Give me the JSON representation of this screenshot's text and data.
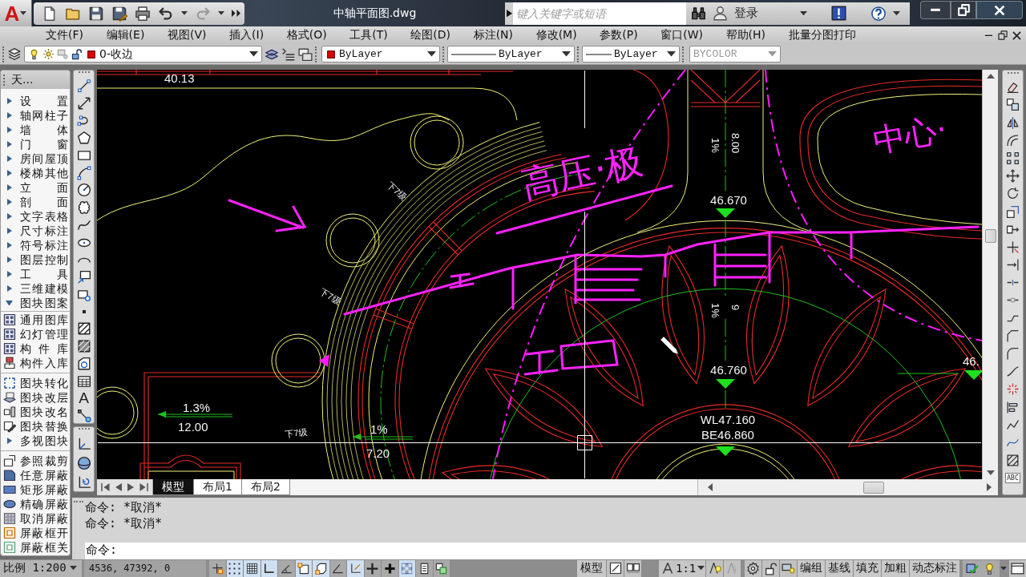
{
  "app_button": {
    "logo": "A"
  },
  "title_bar": {
    "title": "中轴平面图.dwg",
    "search": {
      "placeholder": "键入关键字或短语"
    },
    "sign_in": "登录"
  },
  "menu_bar": {
    "items": [
      "文件(F)",
      "编辑(E)",
      "视图(V)",
      "插入(I)",
      "格式(O)",
      "工具(T)",
      "绘图(D)",
      "标注(N)",
      "修改(M)",
      "参数(P)",
      "窗口(W)",
      "帮助(H)",
      "批量分图打印"
    ]
  },
  "properties_toolbar": {
    "layer": "0-收边",
    "color_setting": "ByLayer",
    "linetype": "ByLayer",
    "lineweight": "ByLayer",
    "plot_style": {
      "value": "BYCOLOR",
      "disabled": true
    }
  },
  "sidebar": {
    "title": "天...",
    "items": [
      {
        "label": "设 置",
        "expanded": false
      },
      {
        "label": "轴网柱子",
        "expanded": false
      },
      {
        "label": "墙 体",
        "expanded": false
      },
      {
        "label": "门 窗",
        "expanded": false
      },
      {
        "label": "房间屋顶",
        "expanded": false
      },
      {
        "label": "楼梯其他",
        "expanded": false
      },
      {
        "label": "立 面",
        "expanded": false
      },
      {
        "label": "剖 面",
        "expanded": false
      },
      {
        "label": "文字表格",
        "expanded": false
      },
      {
        "label": "尺寸标注",
        "expanded": false
      },
      {
        "label": "符号标注",
        "expanded": false
      },
      {
        "label": "图层控制",
        "expanded": false
      },
      {
        "label": "工 具",
        "expanded": false
      },
      {
        "label": "三维建模",
        "expanded": false
      },
      {
        "label": "图块图案",
        "expanded": true,
        "children": [
          {
            "label": "通用图库",
            "kind": "tool",
            "divider_above": false
          },
          {
            "label": "幻灯管理",
            "kind": "tool",
            "divider_above": false
          },
          {
            "label": "构 件 库",
            "kind": "tool",
            "divider_above": false
          },
          {
            "label": "构件入库",
            "kind": "tool",
            "divider_above": false
          },
          {
            "label": "图块转化",
            "kind": "tool",
            "divider_above": true
          },
          {
            "label": "图块改层",
            "kind": "tool",
            "divider_above": false
          },
          {
            "label": "图块改名",
            "kind": "tool",
            "divider_above": false
          },
          {
            "label": "图块替换",
            "kind": "tool",
            "divider_above": false
          },
          {
            "label": "多视图块",
            "kind": "group",
            "expanded": false,
            "divider_above": false
          },
          {
            "label": "参照裁剪",
            "kind": "tool",
            "divider_above": true
          },
          {
            "label": "任意屏蔽",
            "kind": "tool",
            "divider_above": false
          },
          {
            "label": "矩形屏蔽",
            "kind": "tool",
            "divider_above": false
          },
          {
            "label": "精确屏蔽",
            "kind": "tool",
            "divider_above": false
          },
          {
            "label": "取消屏蔽",
            "kind": "tool",
            "divider_above": false
          },
          {
            "label": "屏蔽框开",
            "kind": "tool",
            "divider_above": false
          },
          {
            "label": "屏蔽框关",
            "kind": "tool",
            "divider_above": false
          }
        ]
      }
    ]
  },
  "draw_toolbar": {
    "text_tool": "A"
  },
  "drawing": {
    "texts": [
      "40.13",
      "下7级",
      "下7级",
      "1.3%",
      "12.00",
      "下7级",
      "1%",
      "7.20",
      "1%",
      "8.00",
      "46.670",
      "1%",
      "9",
      "46.760",
      "WL47.160",
      "BE46.860",
      "46."
    ],
    "annotations": [
      "高压·极",
      "中心·"
    ]
  },
  "modify_toolbar": {
    "spell_check": "ABC"
  },
  "layout_tabs": [
    {
      "label": "模型",
      "selected": true
    },
    {
      "label": "布局1",
      "selected": false
    },
    {
      "label": "布局2",
      "selected": false
    }
  ],
  "command_line": {
    "history": [
      "命令: *取消*",
      "命令: *取消*"
    ],
    "prompt": "命令:"
  },
  "status_bar": {
    "scale": "比例 1:200",
    "coordinates": "4536, 47392, 0",
    "toggles": [
      {
        "on": false
      },
      {
        "on": true
      },
      {
        "on": true
      },
      {
        "on": true
      },
      {
        "on": false
      },
      {
        "on": true
      },
      {
        "on": true
      },
      {
        "on": false
      },
      {
        "on": true
      },
      {
        "on": false
      },
      {
        "on": false
      },
      {
        "on": true
      },
      {
        "on": false
      },
      {
        "on": false
      }
    ],
    "model": "模型",
    "annotation_scale": "1:1",
    "buttons": [
      "编组",
      "基线",
      "填充",
      "加粗",
      "动态标注"
    ]
  }
}
